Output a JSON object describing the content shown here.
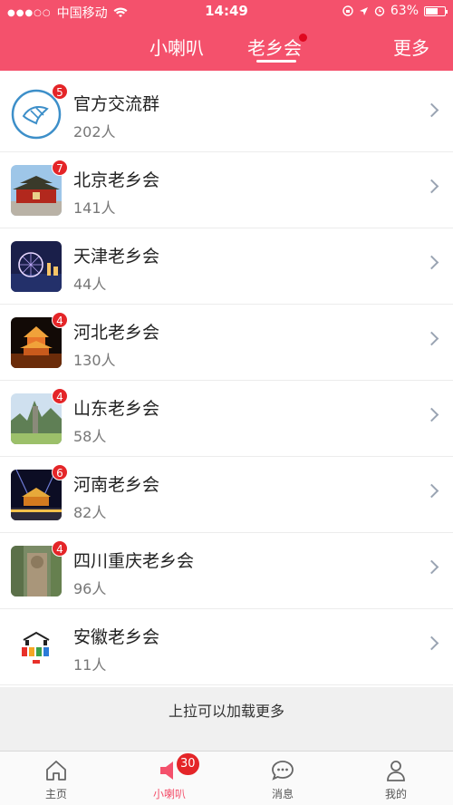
{
  "status": {
    "carrier": "中国移动",
    "time": "14:49",
    "battery": "63%",
    "battery_level": 0.63
  },
  "tabs": [
    {
      "label": "小喇叭"
    },
    {
      "label": "老乡会"
    },
    {
      "label": "更多"
    }
  ],
  "groups": [
    {
      "name": "官方交流群",
      "count": "202人",
      "badge": "5"
    },
    {
      "name": "北京老乡会",
      "count": "141人",
      "badge": "7"
    },
    {
      "name": "天津老乡会",
      "count": "44人",
      "badge": ""
    },
    {
      "name": "河北老乡会",
      "count": "130人",
      "badge": "4"
    },
    {
      "name": "山东老乡会",
      "count": "58人",
      "badge": "4"
    },
    {
      "name": "河南老乡会",
      "count": "82人",
      "badge": "6"
    },
    {
      "name": "四川重庆老乡会",
      "count": "96人",
      "badge": "4"
    },
    {
      "name": "安徽老乡会",
      "count": "11人",
      "badge": ""
    }
  ],
  "load_more": "上拉可以加载更多",
  "tabbar": [
    {
      "label": "主页"
    },
    {
      "label": "小喇叭",
      "badge": "30"
    },
    {
      "label": "消息"
    },
    {
      "label": "我的"
    }
  ],
  "colors": {
    "accent": "#f4516c",
    "badge": "#e42528"
  }
}
